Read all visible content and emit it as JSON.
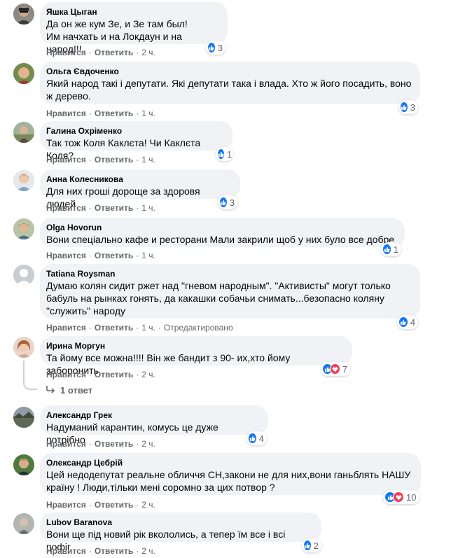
{
  "labels": {
    "like": "Нравится",
    "reply": "Ответить",
    "dot": "·"
  },
  "colors": {
    "bubble": "#f0f2f5",
    "like_blue": "#1877f2",
    "love_red": "#f33e58",
    "meta_gray": "#65676b"
  },
  "comments": [
    {
      "author": "Яшка Цыган",
      "text": "Да он же кум Зе, и Зе там был!\nИм начхать и на Локдаун и на народ!!!",
      "time": "2 ч.",
      "reactions": "3",
      "reaction_types": [
        "like"
      ]
    },
    {
      "author": "Ольга Євдоченко",
      "text": "Який народ такі і депутати. Які депутати така і влада. Хто ж його посадить, воно\nж дерево.",
      "time": "1 ч.",
      "reactions": "3",
      "reaction_types": [
        "like"
      ]
    },
    {
      "author": "Галина Охріменко",
      "text": "Так тож Коля Каклєта! Чи Каклєта Коля?",
      "time": "1 ч.",
      "reactions": "1",
      "reaction_types": [
        "like"
      ]
    },
    {
      "author": "Анна Колесникова",
      "text": "Для них гроші дороще за здоровя людей",
      "time": "1 ч.",
      "reactions": "3",
      "reaction_types": [
        "like"
      ]
    },
    {
      "author": "Olga Hovorun",
      "text": "Вони спеціально кафе и ресторани Мали закрили щоб у них було все добре",
      "time": "1 ч.",
      "reactions": "1",
      "reaction_types": [
        "like"
      ]
    },
    {
      "author": "Tatiana Roysman",
      "text": "Думаю колян сидит ржет над \"гневом народным\". \"Активисты\" могут только\nбабуль на рынках гонять, да какашки собачьи снимать...безопасно коляну\n\"служить\" народу",
      "time": "1 ч.",
      "edited": "Отредактировано",
      "reactions": "4",
      "reaction_types": [
        "like"
      ]
    },
    {
      "author": "Ирина Моргун",
      "text": "Та йому все можна!!!! Він же бандит з 90- их,хто йому заборонить",
      "time": "2 ч.",
      "reactions": "7",
      "reaction_types": [
        "like",
        "love"
      ]
    },
    {
      "author": "Александр Грек",
      "text": "Надуманий карантин, комусь це дуже потрібно",
      "time": "2 ч.",
      "reactions": "4",
      "reaction_types": [
        "like"
      ]
    },
    {
      "author": "Олександр Цебрій",
      "text": "Цей недодепутат реальне обличчя СН,закони не для них,вони ганьблять НАШУ\nкраїну ! Люди,тільки мені соромно за цих потвор ?",
      "time": "2 ч.",
      "reactions": "10",
      "reaction_types": [
        "like",
        "love"
      ]
    },
    {
      "author": "Lubov Baranova",
      "text": "Вони ще під новий рік вкололись, а тепер їм все і всі пофіг.",
      "time": "2 ч.",
      "reactions": "2",
      "reaction_types": [
        "like"
      ]
    }
  ],
  "replies_link": "1 ответ"
}
